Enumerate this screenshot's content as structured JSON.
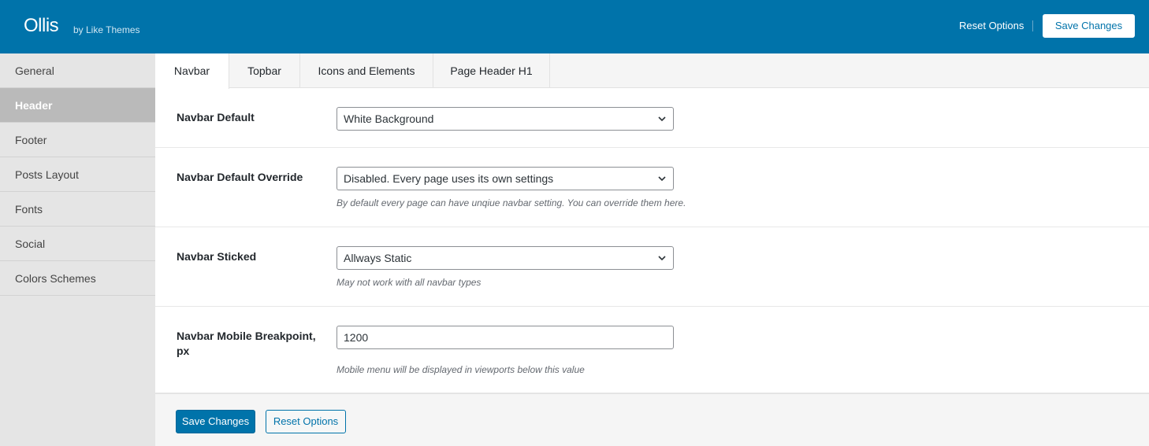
{
  "header": {
    "brand": "Ollis",
    "brand_sub": "by Like Themes",
    "reset_label": "Reset Options",
    "save_label": "Save Changes"
  },
  "sidebar": {
    "items": [
      {
        "label": "General",
        "active": false
      },
      {
        "label": "Header",
        "active": true
      },
      {
        "label": "Footer",
        "active": false
      },
      {
        "label": "Posts Layout",
        "active": false
      },
      {
        "label": "Fonts",
        "active": false
      },
      {
        "label": "Social",
        "active": false
      },
      {
        "label": "Colors Schemes",
        "active": false
      }
    ]
  },
  "tabs": [
    {
      "label": "Navbar",
      "active": true
    },
    {
      "label": "Topbar",
      "active": false
    },
    {
      "label": "Icons and Elements",
      "active": false
    },
    {
      "label": "Page Header H1",
      "active": false
    }
  ],
  "fields": [
    {
      "label": "Navbar Default",
      "type": "select",
      "value": "White Background",
      "description": ""
    },
    {
      "label": "Navbar Default Override",
      "type": "select",
      "value": "Disabled. Every page uses its own settings",
      "description": "By default every page can have unqiue navbar setting. You can override them here."
    },
    {
      "label": "Navbar Sticked",
      "type": "select",
      "value": "Allways Static",
      "description": "May not work with all navbar types"
    },
    {
      "label": "Navbar Mobile Breakpoint, px",
      "type": "text",
      "value": "1200",
      "description": "Mobile menu will be displayed in viewports below this value"
    }
  ],
  "footer": {
    "save_label": "Save Changes",
    "reset_label": "Reset Options"
  },
  "colors": {
    "accent": "#0073aa",
    "sidebar_bg": "#e5e5e5",
    "sidebar_active": "#bababa"
  },
  "icons": {
    "select_arrow": "chevron-down-icon"
  }
}
